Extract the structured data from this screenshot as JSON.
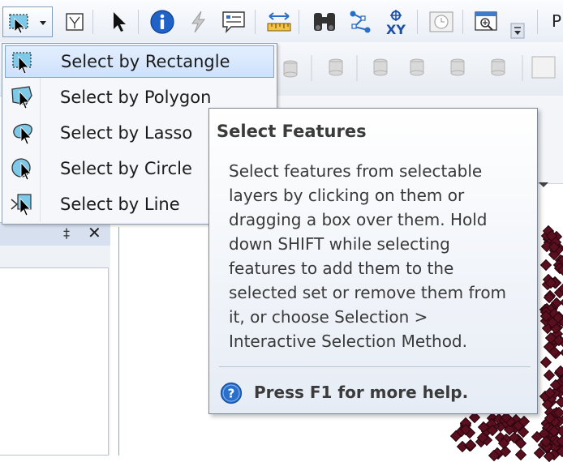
{
  "colors": {
    "menu_highlight": "#cde1fb",
    "tooltip_bg": "#eef2f8",
    "map_feature": "#5a0f1e",
    "help_icon": "#2a6fc9"
  },
  "toolbar": {
    "icons": [
      "select-by-rectangle-icon",
      "select-elements-icon",
      "select-pointer-icon",
      "identify-icon",
      "hyperlink-icon",
      "html-popup-icon",
      "measure-icon",
      "find-icon",
      "find-route-icon",
      "go-to-xy-icon",
      "time-slider-icon",
      "create-viewer-window-icon",
      "toolbar-options-icon"
    ],
    "xy_label": "XY",
    "partial_text": "P"
  },
  "select_menu": {
    "items": [
      {
        "label": "Select by Rectangle",
        "icon": "select-rectangle-icon",
        "highlighted": true
      },
      {
        "label": "Select by Polygon",
        "icon": "select-polygon-icon",
        "highlighted": false
      },
      {
        "label": "Select by Lasso",
        "icon": "select-lasso-icon",
        "highlighted": false
      },
      {
        "label": "Select by Circle",
        "icon": "select-circle-icon",
        "highlighted": false
      },
      {
        "label": "Select by Line",
        "icon": "select-line-icon",
        "highlighted": false
      }
    ]
  },
  "tooltip": {
    "title": "Select Features",
    "description": "Select features from selectable\nlayers by clicking on them or\ndragging a box over them. Hold\ndown SHIFT while selecting\nfeatures to add them to the\nselected set or remove them from\nit, or choose Selection >\nInteractive Selection Method.",
    "help_text": "Press F1 for more help."
  },
  "panel": {
    "pin_glyph": "‡",
    "close_glyph": "✕"
  }
}
